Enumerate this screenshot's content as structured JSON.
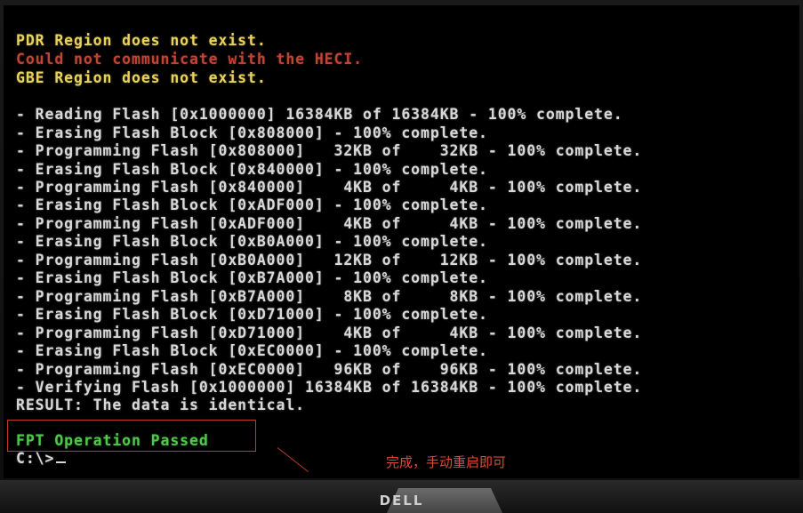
{
  "console": {
    "lines": [
      {
        "text": "PDR Region does not exist.",
        "color": "yellow"
      },
      {
        "text": "Could not communicate with the HECI.",
        "color": "red"
      },
      {
        "text": "GBE Region does not exist.",
        "color": "yellow"
      },
      {
        "text": "",
        "color": "white"
      },
      {
        "text": "- Reading Flash [0x1000000] 16384KB of 16384KB - 100% complete.",
        "color": "white"
      },
      {
        "text": "- Erasing Flash Block [0x808000] - 100% complete.",
        "color": "white"
      },
      {
        "text": "- Programming Flash [0x808000]   32KB of    32KB - 100% complete.",
        "color": "white"
      },
      {
        "text": "- Erasing Flash Block [0x840000] - 100% complete.",
        "color": "white"
      },
      {
        "text": "- Programming Flash [0x840000]    4KB of     4KB - 100% complete.",
        "color": "white"
      },
      {
        "text": "- Erasing Flash Block [0xADF000] - 100% complete.",
        "color": "white"
      },
      {
        "text": "- Programming Flash [0xADF000]    4KB of     4KB - 100% complete.",
        "color": "white"
      },
      {
        "text": "- Erasing Flash Block [0xB0A000] - 100% complete.",
        "color": "white"
      },
      {
        "text": "- Programming Flash [0xB0A000]   12KB of    12KB - 100% complete.",
        "color": "white"
      },
      {
        "text": "- Erasing Flash Block [0xB7A000] - 100% complete.",
        "color": "white"
      },
      {
        "text": "- Programming Flash [0xB7A000]    8KB of     8KB - 100% complete.",
        "color": "white"
      },
      {
        "text": "- Erasing Flash Block [0xD71000] - 100% complete.",
        "color": "white"
      },
      {
        "text": "- Programming Flash [0xD71000]    4KB of     4KB - 100% complete.",
        "color": "white"
      },
      {
        "text": "- Erasing Flash Block [0xEC0000] - 100% complete.",
        "color": "white"
      },
      {
        "text": "- Programming Flash [0xEC0000]   96KB of    96KB - 100% complete.",
        "color": "white"
      },
      {
        "text": "- Verifying Flash [0x1000000] 16384KB of 16384KB - 100% complete.",
        "color": "white"
      },
      {
        "text": "RESULT: The data is identical.",
        "color": "white"
      },
      {
        "text": "",
        "color": "white"
      },
      {
        "text": "FPT Operation Passed",
        "color": "green"
      }
    ],
    "prompt": "C:\\>"
  },
  "annotation": {
    "text": "完成，手动重启即可",
    "color": "#e0473a"
  },
  "monitor": {
    "brand": "DELL"
  }
}
